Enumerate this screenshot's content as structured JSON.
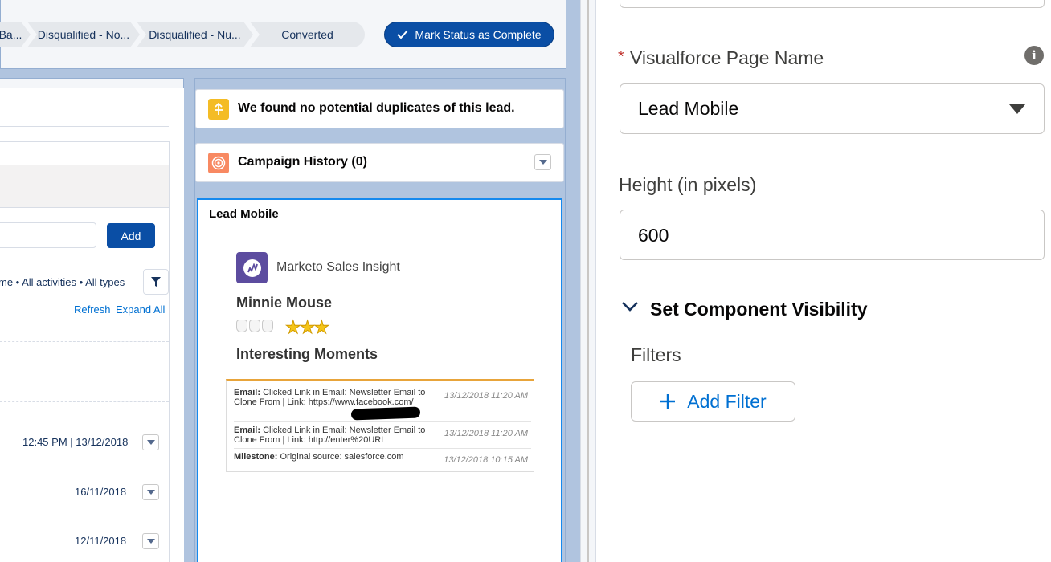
{
  "path": {
    "stages": [
      "Ba...",
      "Disqualified - No...",
      "Disqualified - Nu...",
      "Converted"
    ],
    "mark_status_label": "Mark Status as Complete"
  },
  "activity": {
    "add_label": "Add",
    "filter_text": "me • All activities • All types",
    "refresh_label": "Refresh",
    "expand_all_label": "Expand All",
    "dates": [
      "12:45 PM | 13/12/2018",
      "16/11/2018",
      "12/11/2018"
    ]
  },
  "duplicates": {
    "message": "We found no potential duplicates of this lead."
  },
  "campaign": {
    "title": "Campaign History (0)"
  },
  "visualforce": {
    "card_title": "Lead Mobile",
    "app_name": "Marketo Sales Insight",
    "lead_name": "Minnie Mouse",
    "stars": "★★★",
    "moments_heading": "Interesting Moments",
    "moments": [
      {
        "type": "Email:",
        "text": "Clicked Link in Email: Newsletter Email to Clone From | Link: https://www.facebook.com/",
        "date": "13/12/2018 11:20 AM"
      },
      {
        "type": "Email:",
        "text": "Clicked Link in Email: Newsletter Email to Clone From | Link: http://enter%20URL",
        "date": "13/12/2018 11:20 AM"
      },
      {
        "type": "Milestone:",
        "text": "Original source: salesforce.com",
        "date": "13/12/2018 10:15 AM"
      }
    ]
  },
  "properties": {
    "required_marker": "*",
    "vf_page_label": "Visualforce Page Name",
    "vf_page_value": "Lead Mobile",
    "height_label": "Height (in pixels)",
    "height_value": "600",
    "visibility_heading": "Set Component Visibility",
    "filters_label": "Filters",
    "add_filter_label": "Add Filter"
  },
  "colors": {
    "brand_button": "#0a4ea5",
    "link": "#0070d2",
    "canvas_bg": "#b0c4df",
    "selected_outline": "#1589ee"
  }
}
